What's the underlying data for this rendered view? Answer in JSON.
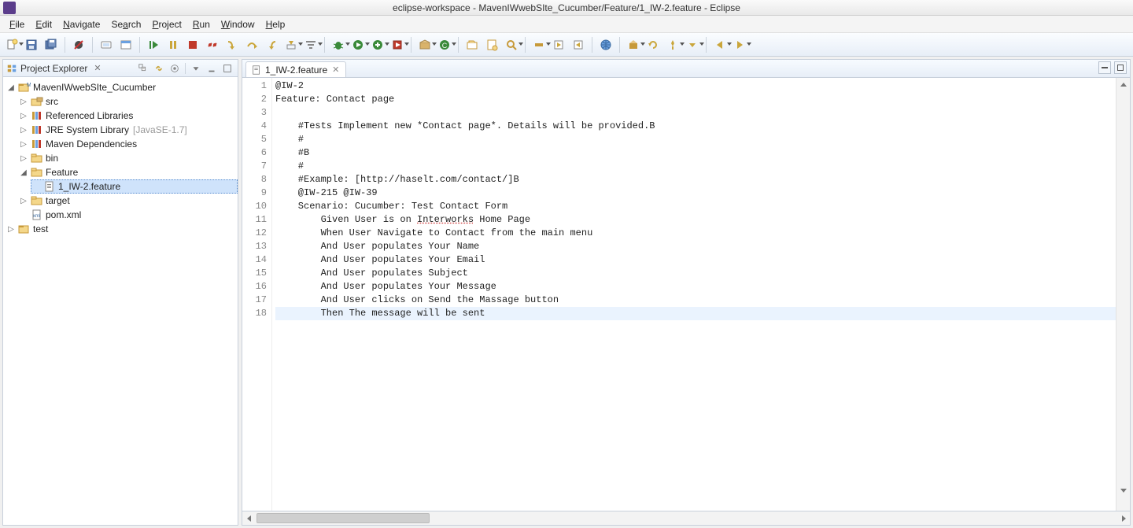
{
  "window": {
    "title": "eclipse-workspace - MavenIWwebSIte_Cucumber/Feature/1_IW-2.feature - Eclipse"
  },
  "menu": {
    "file": {
      "label": "File",
      "key": "F"
    },
    "edit": {
      "label": "Edit",
      "key": "E"
    },
    "navigate": {
      "label": "Navigate",
      "key": "N"
    },
    "search": {
      "label": "Search",
      "key": "S"
    },
    "project": {
      "label": "Project",
      "key": "P"
    },
    "run": {
      "label": "Run",
      "key": "R"
    },
    "window": {
      "label": "Window",
      "key": "W"
    },
    "help": {
      "label": "Help",
      "key": "H"
    }
  },
  "toolbar": {
    "new": "New",
    "save": "Save",
    "saveall": "Save All",
    "skipbp": "Skip All Breakpoints",
    "resume": "Resume",
    "suspend": "Suspend",
    "terminate": "Terminate",
    "disconnect": "Disconnect",
    "stepinto": "Step Into",
    "stepover": "Step Over",
    "stepreturn": "Step Return",
    "debug": "Debug",
    "run": "Run",
    "coverage": "Coverage",
    "runlast": "Run Last",
    "newpkg": "New Java Package",
    "newclass": "New Java Class",
    "opentype": "Open Type",
    "opentask": "Open Task",
    "search": "Search",
    "toggle": "Toggle Breadcrumb",
    "annotations": "Annotations",
    "web": "Open Web Browser",
    "refresh": "Refresh",
    "pin": "Pin",
    "back": "Back",
    "forward": "Forward"
  },
  "explorer": {
    "title": "Project Explorer",
    "tree": {
      "project": "MavenIWwebSIte_Cucumber",
      "src": "src",
      "reflib": "Referenced Libraries",
      "jre": "JRE System Library",
      "jre_decor": "[JavaSE-1.7]",
      "maven": "Maven Dependencies",
      "bin": "bin",
      "feature": "Feature",
      "feature_file": "1_IW-2.feature",
      "target": "target",
      "pom": "pom.xml",
      "test": "test"
    }
  },
  "editor": {
    "tab": "1_IW-2.feature",
    "lines": [
      "@IW-2",
      "Feature: Contact page",
      "",
      "    #Tests Implement new *Contact page*. Details will be provided.В",
      "    #",
      "    #В",
      "    #",
      "    #Example: [http://haselt.com/contact/]В",
      "    @IW-215 @IW-39",
      "    Scenario: Cucumber: Test Contact Form",
      "        Given User is on Interworks Home Page",
      "        When User Navigate to Contact from the main menu",
      "        And User populates Your Name",
      "        And User populates Your Email",
      "        And User populates Subject",
      "        And User populates Your Message",
      "        And User clicks on Send the Massage button",
      "        Then The message will be sent"
    ],
    "underlined_word_line": 11,
    "underlined_word": "Interworks",
    "caret_line": 18
  }
}
